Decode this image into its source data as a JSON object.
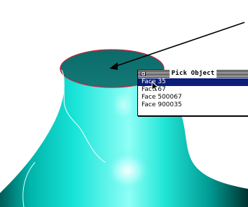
{
  "scene": {
    "model_color": "#12e0d2",
    "shadow_color": "#003c38",
    "highlight_color": "#f4ffff",
    "edge_color": "#d2203c",
    "annotation_color": "#000000"
  },
  "pick_window": {
    "title": "Pick Object",
    "selection_color": "#0a1e7a",
    "items": [
      {
        "label": "Face 35",
        "selected": true
      },
      {
        "label": "Face 67",
        "selected": false
      },
      {
        "label": "Face 500067",
        "selected": false
      },
      {
        "label": "Face 900035",
        "selected": false
      }
    ]
  },
  "cursor": {
    "icon": "arrow-pointer-icon"
  }
}
